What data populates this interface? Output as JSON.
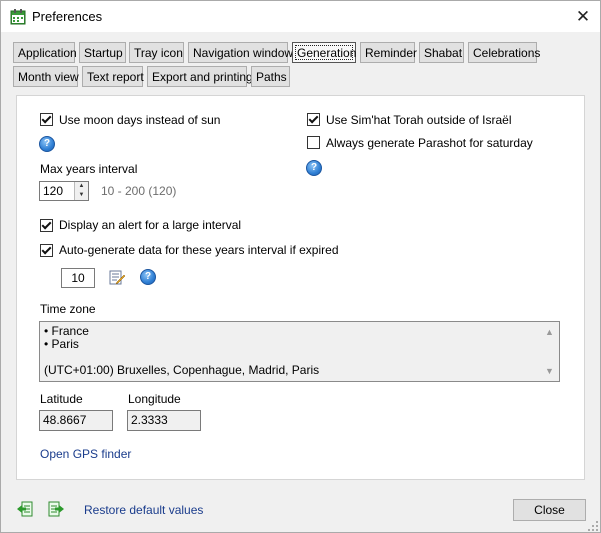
{
  "window": {
    "title": "Preferences"
  },
  "tabs_row1": [
    "Application",
    "Startup",
    "Tray icon",
    "Navigation window",
    "Generation",
    "Reminder",
    "Shabat",
    "Celebrations"
  ],
  "tabs_row2": [
    "Month view",
    "Text report",
    "Export and printing",
    "Paths"
  ],
  "active_tab": "Generation",
  "generation": {
    "use_moon_days": {
      "label": "Use moon days instead of sun",
      "checked": true
    },
    "use_simhat_torah": {
      "label": "Use Sim'hat Torah outside of Israël",
      "checked": true
    },
    "always_parashot": {
      "label": "Always generate Parashot for saturday",
      "checked": false
    },
    "max_years": {
      "label": "Max years interval",
      "value": "120",
      "range_hint": "10 - 200 (120)"
    },
    "display_alert": {
      "label": "Display an alert for a large interval",
      "checked": true
    },
    "auto_generate": {
      "label": "Auto-generate data for these years interval if expired",
      "checked": true,
      "value": "10"
    },
    "time_zone": {
      "label": "Time zone",
      "line1": "• France",
      "line2": "• Paris",
      "line3": "(UTC+01:00) Bruxelles, Copenhague, Madrid, Paris"
    },
    "latitude": {
      "label": "Latitude",
      "value": "48.8667"
    },
    "longitude": {
      "label": "Longitude",
      "value": "2.3333"
    },
    "gps_link": "Open GPS finder"
  },
  "footer": {
    "restore_link": "Restore default values",
    "close_label": "Close"
  },
  "icons": {
    "app": "calendar-app-icon",
    "help": "help-icon",
    "edit": "edit-icon",
    "import": "import-icon",
    "export": "export-icon"
  },
  "colors": {
    "link": "#1a3c8c",
    "help_blue": "#2f7fd4",
    "panel_bg": "#ffffff",
    "window_bg": "#f0f0f0"
  }
}
